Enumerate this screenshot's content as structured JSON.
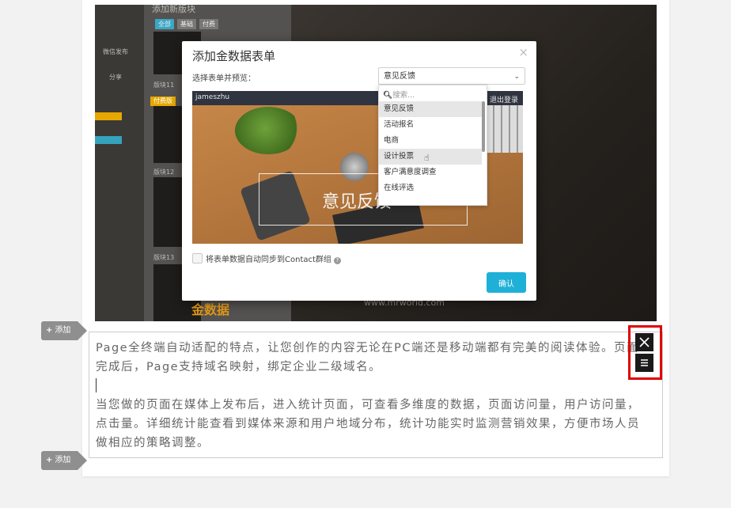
{
  "screenshot": {
    "panel_title": "添加新版块",
    "chips": [
      "全部",
      "基础",
      "付费"
    ],
    "side_labels": [
      "微信发布",
      "分享"
    ],
    "tile_labels": [
      "版块11",
      "版块12",
      "版块13"
    ],
    "badge": "付费版",
    "logo_text": "金数据",
    "watermark": "www.mrworld.com"
  },
  "modal": {
    "title": "添加金数据表单",
    "select_label": "选择表单并预览：",
    "selected": "意见反馈",
    "search_placeholder": "搜索...",
    "options": [
      "意见反馈",
      "活动报名",
      "电商",
      "设计投票",
      "客户满意度调查",
      "在线评选"
    ],
    "preview_user": "jameszhu",
    "preview_logout": "退出登录",
    "preview_overlay": "意见反馈",
    "sync_label": "将表单数据自动同步到Contact群组",
    "confirm": "确认"
  },
  "add_label": "添加",
  "content": {
    "para1": "Page全终端自动适配的特点，让您创作的内容无论在PC端还是移动端都有完美的阅读体验。页面完成后，Page支持域名映射，绑定企业二级域名。",
    "para2": "当您做的页面在媒体上发布后，进入统计页面，可查看多维度的数据，页面访问量，用户访问量，点击量。详细统计能查看到媒体来源和用户地域分布，统计功能实时监测营销效果，方便市场人员做相应的策略调整。"
  },
  "colors": {
    "confirm_button": "#1fb0d8",
    "highlight_frame": "#e00000",
    "add_tag": "#8f8f8f"
  }
}
